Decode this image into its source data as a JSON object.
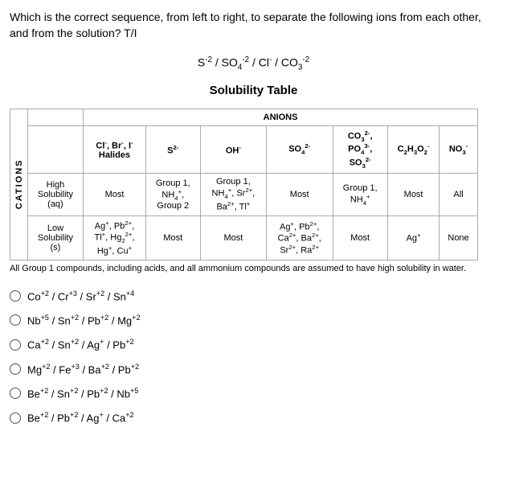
{
  "question": "Which is the correct sequence, from left to right, to separate the following ions from each other, and from the solution? T/I",
  "formula_html": "S<sup>-2</sup> / SO<sub>4</sub><sup>-2</sup> / Cl<sup>-</sup> / CO<sub>3</sub><sup>-2</sup>",
  "table_title": "Solubility Table",
  "headers": {
    "anions": "ANIONS",
    "cations": "CATIONS",
    "halides_html": "Cl<sup>-</sup>, Br<sup>-</sup>, I<sup>-</sup><br>Halides",
    "s2_html": "S<sup>2-</sup>",
    "oh_html": "OH<sup>-</sup>",
    "so4_html": "SO<sub>4</sub><sup>2-</sup>",
    "co3_html": "CO<sub>3</sub><sup>2-</sup>,<br>PO<sub>4</sub><sup>3-</sup>,<br>SO<sub>3</sub><sup>2-</sup>",
    "acet_html": "C<sub>2</sub>H<sub>3</sub>O<sub>2</sub><sup>-</sup>",
    "no3_html": "NO<sub>3</sub><sup>-</sup>"
  },
  "rows": {
    "high": {
      "label_html": "High<br>Solubility<br>(aq)",
      "halides": "Most",
      "s2_html": "Group 1,<br>NH<sub>4</sub><sup>+</sup>,<br>Group 2",
      "oh_html": "Group 1,<br>NH<sub>4</sub><sup>+</sup>, Sr<sup>2+</sup>,<br>Ba<sup>2+</sup>, Tl<sup>+</sup>",
      "so4": "Most",
      "co3_html": "Group 1,<br>NH<sub>4</sub><sup>+</sup>",
      "acet": "Most",
      "no3": "All"
    },
    "low": {
      "label_html": "Low<br>Solubility<br>(s)",
      "halides_html": "Ag<sup>+</sup>, Pb<sup>2+</sup>,<br>Tl<sup>+</sup>, Hg<sub>2</sub><sup>2+</sup>,<br>Hg<sup>+</sup>, Cu<sup>+</sup>",
      "s2": "Most",
      "oh": "Most",
      "so4_html": "Ag<sup>+</sup>, Pb<sup>2+</sup>,<br>Ca<sup>2+</sup>, Ba<sup>2+</sup>,<br>Sr<sup>2+</sup>, Ra<sup>2+</sup>",
      "co3": "Most",
      "acet_html": "Ag<sup>+</sup>",
      "no3": "None"
    }
  },
  "footnote": "All Group 1 compounds, including acids, and all ammonium compounds are assumed to have high solubility in water.",
  "options": {
    "a_html": "Co<sup>+2</sup> / Cr<sup>+3</sup> / Sr<sup>+2</sup> / Sn<sup>+4</sup>",
    "b_html": "Nb<sup>+5</sup> / Sn<sup>+2</sup> / Pb<sup>+2</sup> / Mg<sup>+2</sup>",
    "c_html": "Ca<sup>+2</sup> / Sn<sup>+2</sup> / Ag<sup>+</sup> / Pb<sup>+2</sup>",
    "d_html": "Mg<sup>+2</sup> / Fe<sup>+3</sup> / Ba<sup>+2</sup> / Pb<sup>+2</sup>",
    "e_html": "Be<sup>+2</sup> / Sn<sup>+2</sup> / Pb<sup>+2</sup> / Nb<sup>+5</sup>",
    "f_html": "Be<sup>+2</sup> / Pb<sup>+2</sup> / Ag<sup>+</sup> / Ca<sup>+2</sup>"
  }
}
